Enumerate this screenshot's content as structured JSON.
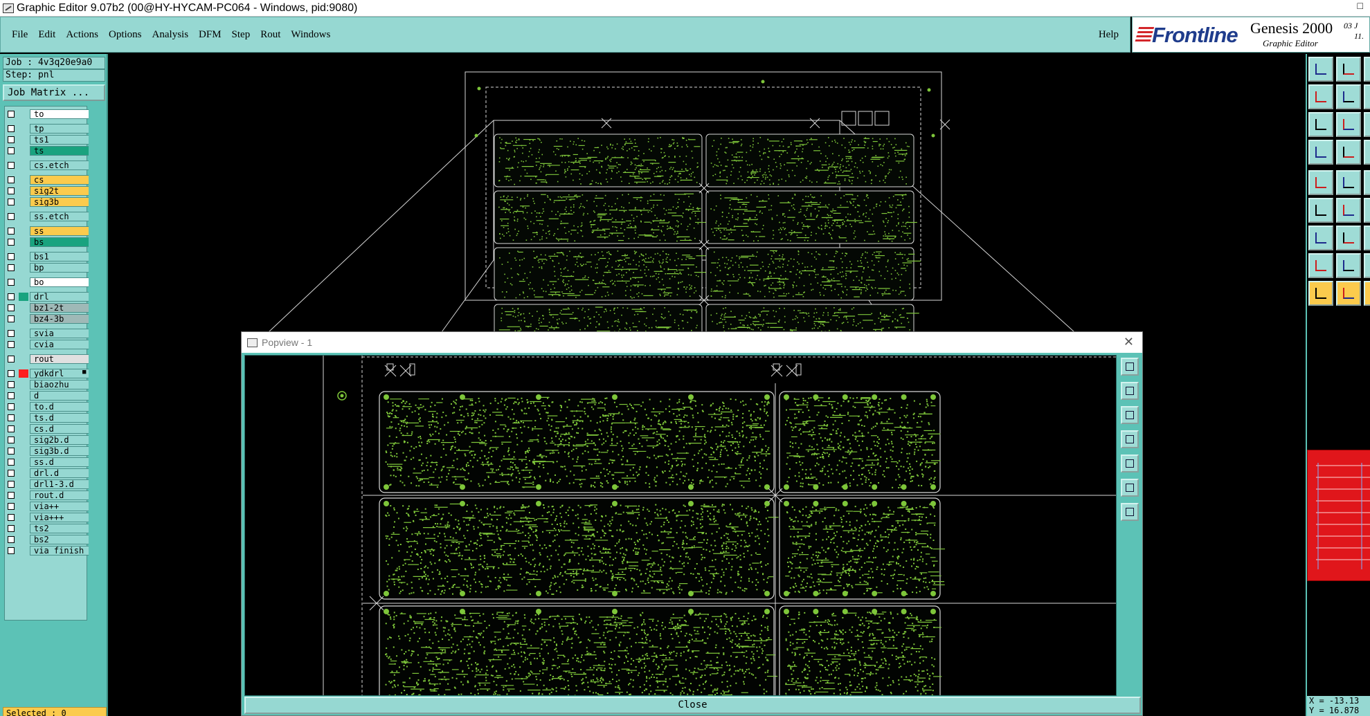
{
  "window": {
    "title": "Graphic Editor 9.07b2 (00@HY-HYCAM-PC064 - Windows, pid:9080)",
    "control": "□"
  },
  "menu": {
    "items": [
      "File",
      "Edit",
      "Actions",
      "Options",
      "Analysis",
      "DFM",
      "Step",
      "Rout",
      "Windows"
    ],
    "help": "Help"
  },
  "logo": {
    "brand": "Frontline",
    "product": "Genesis 2000",
    "subtitle": "Graphic Editor",
    "date_line1": "03 J",
    "date_line2": "11."
  },
  "job": {
    "job_label": "Job : 4v3q20e9a0",
    "step_label": "Step: pnl",
    "matrix_button": "Job Matrix ..."
  },
  "layers": [
    {
      "name": "to",
      "color": "#ffffff",
      "gap_before": false
    },
    {
      "name": "tp",
      "color": "#96d8d2",
      "gap_before": true
    },
    {
      "name": "ts1",
      "color": "#96d8d2",
      "gap_before": false
    },
    {
      "name": "ts",
      "color": "#1aa37f",
      "gap_before": false
    },
    {
      "name": "cs.etch",
      "color": "#96d8d2",
      "gap_before": true
    },
    {
      "name": "cs",
      "color": "#fbcb4d",
      "gap_before": true
    },
    {
      "name": "sig2t",
      "color": "#fbcb4d",
      "gap_before": false
    },
    {
      "name": "sig3b",
      "color": "#fbcb4d",
      "gap_before": false
    },
    {
      "name": "ss.etch",
      "color": "#96d8d2",
      "gap_before": true
    },
    {
      "name": "ss",
      "color": "#fbcb4d",
      "gap_before": true
    },
    {
      "name": "bs",
      "color": "#1aa37f",
      "gap_before": false
    },
    {
      "name": "bs1",
      "color": "#96d8d2",
      "gap_before": true
    },
    {
      "name": "bp",
      "color": "#96d8d2",
      "gap_before": false
    },
    {
      "name": "bo",
      "color": "#ffffff",
      "gap_before": true
    },
    {
      "name": "drl",
      "color": "#96d8d2",
      "gap_before": true,
      "swatch": "#1aa37f"
    },
    {
      "name": "bz1-2t",
      "color": "#9fb9b7",
      "gap_before": false
    },
    {
      "name": "bz4-3b",
      "color": "#9fb9b7",
      "gap_before": false
    },
    {
      "name": "svia",
      "color": "#96d8d2",
      "gap_before": true
    },
    {
      "name": "cvia",
      "color": "#96d8d2",
      "gap_before": false
    },
    {
      "name": "rout",
      "color": "#e0e0e0",
      "gap_before": true
    },
    {
      "name": "ydkdrl",
      "color": "#96d8d2",
      "gap_before": true,
      "swatch": "#ff2020",
      "marker": "■"
    },
    {
      "name": "biaozhu",
      "color": "#96d8d2",
      "gap_before": false
    },
    {
      "name": "d",
      "color": "#96d8d2",
      "gap_before": false
    },
    {
      "name": "to.d",
      "color": "#96d8d2",
      "gap_before": false
    },
    {
      "name": "ts.d",
      "color": "#96d8d2",
      "gap_before": false
    },
    {
      "name": "cs.d",
      "color": "#96d8d2",
      "gap_before": false
    },
    {
      "name": "sig2b.d",
      "color": "#96d8d2",
      "gap_before": false
    },
    {
      "name": "sig3b.d",
      "color": "#96d8d2",
      "gap_before": false
    },
    {
      "name": "ss.d",
      "color": "#96d8d2",
      "gap_before": false
    },
    {
      "name": "drl.d",
      "color": "#96d8d2",
      "gap_before": false
    },
    {
      "name": "drl1-3.d",
      "color": "#96d8d2",
      "gap_before": false
    },
    {
      "name": "rout.d",
      "color": "#96d8d2",
      "gap_before": false
    },
    {
      "name": "via++",
      "color": "#96d8d2",
      "gap_before": false
    },
    {
      "name": "via+++",
      "color": "#96d8d2",
      "gap_before": false
    },
    {
      "name": "ts2",
      "color": "#96d8d2",
      "gap_before": false
    },
    {
      "name": "bs2",
      "color": "#96d8d2",
      "gap_before": false
    },
    {
      "name": "via_finish_",
      "color": "#96d8d2",
      "gap_before": false
    }
  ],
  "status": {
    "selected": "Selected : 0"
  },
  "coords": {
    "x": "X = -13.13",
    "y": "Y = 16.878"
  },
  "popview": {
    "title": "Popview - 1",
    "close_glyph": "✕",
    "close_button": "Close"
  },
  "colors": {
    "panel": "#5cc2b6",
    "menu": "#96d8d2",
    "trace": "#7ec63a",
    "outline": "#d8d8d8"
  }
}
